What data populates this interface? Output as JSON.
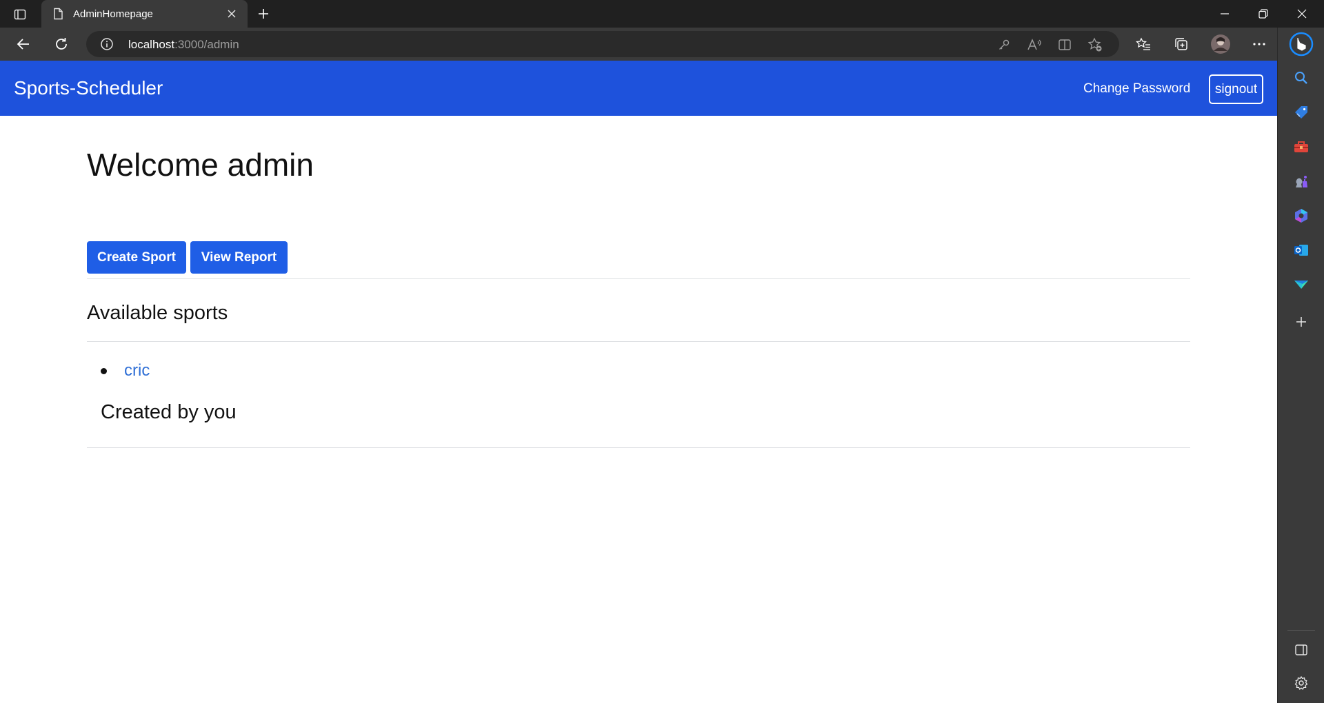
{
  "browser": {
    "tab_title": "AdminHomepage",
    "url_host": "localhost",
    "url_rest": ":3000/admin",
    "icons": {
      "tab_actions": "tab-actions-icon",
      "page": "page-icon",
      "close_tab": "close-icon",
      "new_tab": "plus-icon",
      "minimize": "minimize-icon",
      "restore": "restore-icon",
      "close_window": "close-window-icon",
      "back": "back-arrow-icon",
      "refresh": "refresh-icon",
      "site_info": "info-icon",
      "passwords": "key-icon",
      "read_aloud": "read-aloud-icon",
      "split_screen": "split-screen-icon",
      "add_favorite": "star-add-icon",
      "favorites": "favorites-icon",
      "collections": "collections-icon",
      "profile": "avatar",
      "more": "more-icon",
      "copilot": "bing-icon"
    }
  },
  "navbar": {
    "brand": "Sports-Scheduler",
    "change_password": "Change Password",
    "signout": "signout",
    "color": "#1e52dc"
  },
  "main": {
    "welcome": "Welcome admin",
    "create_sport": "Create Sport",
    "view_report": "View Report",
    "available_sports_title": "Available sports",
    "sports": [
      "cric"
    ],
    "created_by": "Created by you"
  },
  "sidebar": {
    "items": [
      "search-icon",
      "shopping-tag-icon",
      "toolbox-icon",
      "games-icon",
      "microsoft365-icon",
      "outlook-icon",
      "drop-icon",
      "add-icon",
      "sidebar-toggle-icon",
      "settings-icon"
    ]
  }
}
